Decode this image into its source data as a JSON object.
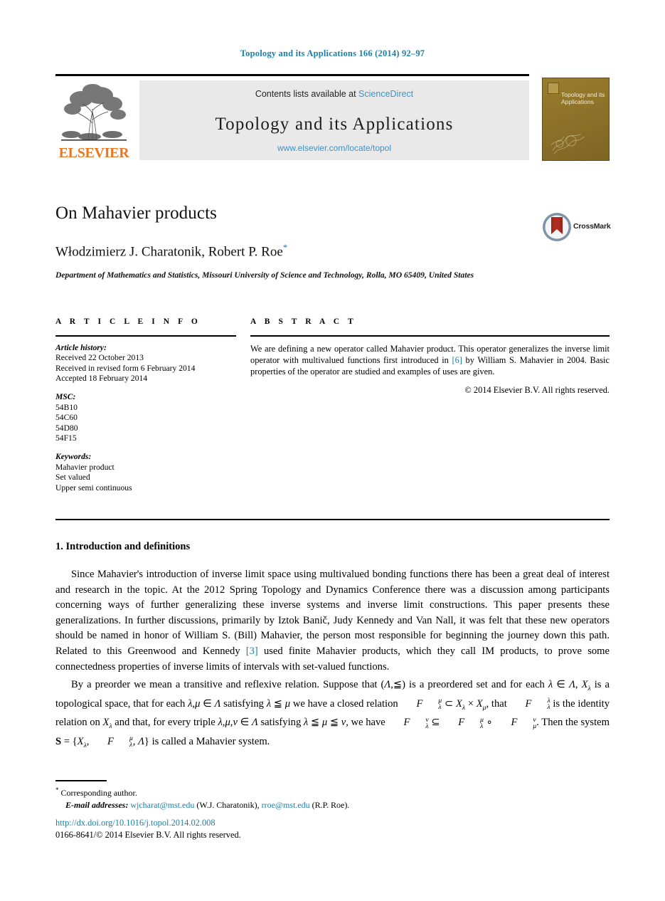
{
  "running_head": "Topology and its Applications 166 (2014) 92–97",
  "masthead": {
    "publisher_name": "ELSEVIER",
    "contents_prefix": "Contents lists available at ",
    "sciencedirect": "ScienceDirect",
    "journal_title": "Topology  and  its  Applications",
    "journal_url": "www.elsevier.com/locate/topol",
    "cover_title": "Topology and its Applications"
  },
  "article": {
    "title": "On Mahavier products",
    "authors": "Włodzimierz J. Charatonik, Robert P. Roe",
    "corresponding_marker": "*",
    "affiliation": "Department of Mathematics and Statistics, Missouri University of Science and Technology, Rolla, MO 65409, United States",
    "crossmark_label": "CrossMark"
  },
  "info": {
    "heading": "A R T I C L E   I N F O",
    "history_label": "Article history:",
    "history": [
      "Received 22 October 2013",
      "Received in revised form 6 February 2014",
      "Accepted 18 February 2014"
    ],
    "msc_label": "MSC:",
    "msc": [
      "54B10",
      "54C60",
      "54D80",
      "54F15"
    ],
    "keywords_label": "Keywords:",
    "keywords": [
      "Mahavier product",
      "Set valued",
      "Upper semi continuous"
    ]
  },
  "abstract": {
    "heading": "A B S T R A C T",
    "text_part1": "We are defining a new operator called Mahavier product. This operator generalizes the inverse limit operator with multivalued functions first introduced in ",
    "ref": "[6]",
    "text_part2": " by William S. Mahavier in 2004. Basic properties of the operator are studied and examples of uses are given.",
    "copyright": "© 2014 Elsevier B.V. All rights reserved."
  },
  "section": {
    "heading": "1. Introduction and definitions",
    "para1_part1": "Since Mahavier's introduction of inverse limit space using multivalued bonding functions there has been a great deal of interest and research in the topic. At the 2012 Spring Topology and Dynamics Conference there was a discussion among participants concerning ways of further generalizing these inverse systems and inverse limit constructions. This paper presents these generalizations. In further discussions, primarily by Iztok Banič, Judy Kennedy and Van Nall, it was felt that these new operators should be named in honor of William S. (Bill) Mahavier, the person most responsible for beginning the journey down this path. Related to this Greenwood and Kennedy ",
    "para1_ref": "[3]",
    "para1_part2": " used finite Mahavier products, which they call IM products, to prove some connectedness properties of inverse limits of intervals with set-valued functions.",
    "para2": "By a preorder we mean a transitive and reflexive relation. Suppose that (Λ, ⩽) is a preordered set and for each λ ∈ Λ, Xλ is a topological space, that for each λ, μ ∈ Λ satisfying λ ⩽ μ we have a closed relation Fλ^μ ⊂ Xλ × Xμ, that Fλ^λ is the identity relation on Xλ and that, for every triple λ, μ, ν ∈ Λ satisfying λ ⩽ μ ⩽ ν, we have Fλ^ν ⊆ Fλ^μ ∘ Fμ^ν. Then the system S = {Xλ, Fλ^μ, Λ} is called a Mahavier system."
  },
  "footer": {
    "corresponding_note": "Corresponding author.",
    "email_label": "E-mail addresses:",
    "email1": "wjcharat@mst.edu",
    "email1_owner": "(W.J. Charatonik),",
    "email2": "rroe@mst.edu",
    "email2_owner": "(R.P. Roe).",
    "doi": "http://dx.doi.org/10.1016/j.topol.2014.02.008",
    "issn_line": "0166-8641/© 2014 Elsevier B.V. All rights reserved."
  },
  "colors": {
    "link": "#1b7fa8",
    "sciencedirect": "#3d92c8",
    "elsevier_orange": "#e87722",
    "cover": "#8d7229"
  }
}
